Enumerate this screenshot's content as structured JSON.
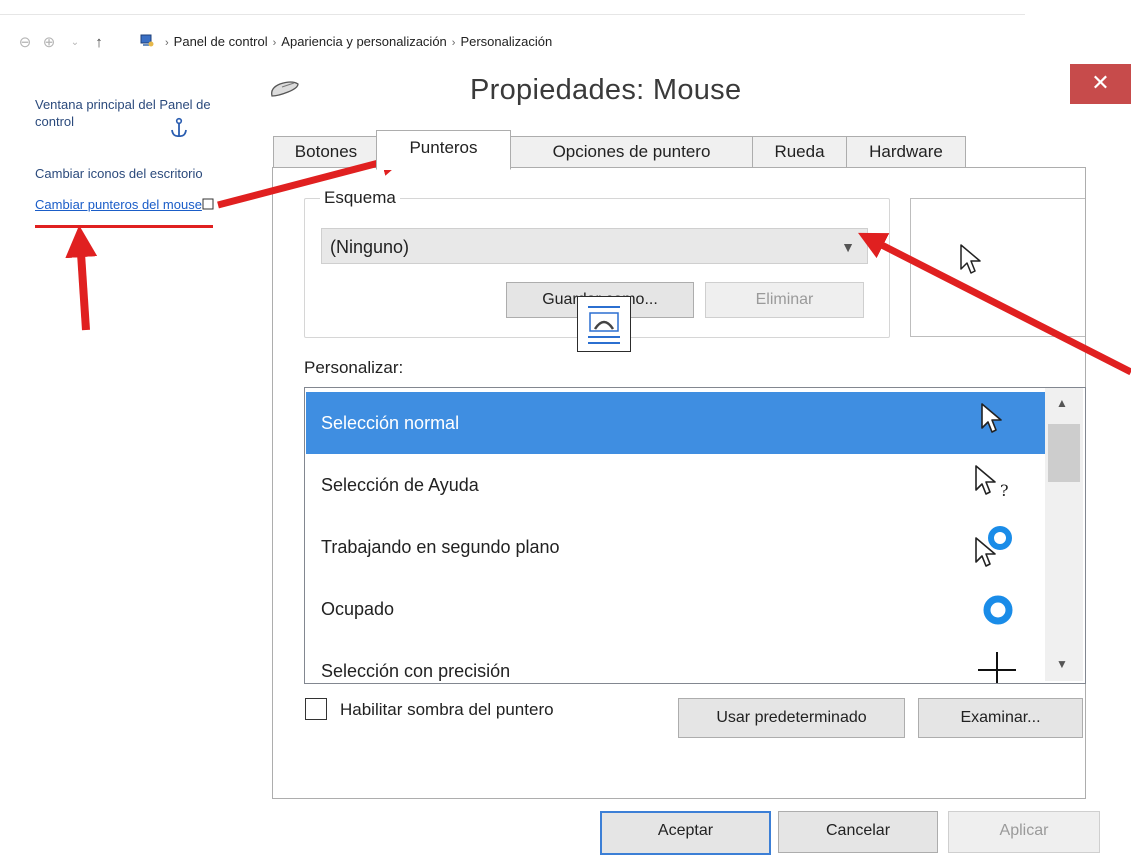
{
  "breadcrumb": {
    "items": [
      "Panel de control",
      "Apariencia y personalización",
      "Personalización"
    ],
    "separator": "›"
  },
  "left_panel": {
    "home_link": "Ventana principal del Panel de control",
    "desktop_icons_link": "Cambiar iconos del escritorio",
    "mouse_pointers_link": "Cambiar punteros del mouse"
  },
  "dialog": {
    "title": "Propiedades: Mouse",
    "close_glyph": "✕",
    "tabs": [
      "Botones",
      "Punteros",
      "Opciones de puntero",
      "Rueda",
      "Hardware"
    ],
    "active_tab": "Punteros",
    "scheme": {
      "label": "Esquema",
      "selected": "(Ninguno)",
      "save_button": "Guardar como...",
      "delete_button": "Eliminar"
    },
    "customize_label": "Personalizar:",
    "pointers": [
      {
        "label": "Selección normal",
        "icon": "arrow-pointer-icon",
        "selected": true
      },
      {
        "label": "Selección de Ayuda",
        "icon": "help-select-pointer-icon",
        "selected": false
      },
      {
        "label": "Trabajando en segundo plano",
        "icon": "working-background-pointer-icon",
        "selected": false
      },
      {
        "label": "Ocupado",
        "icon": "busy-ring-icon",
        "selected": false
      },
      {
        "label": "Selección con precisión",
        "icon": "crosshair-icon",
        "selected": false
      }
    ],
    "shadow_checkbox": {
      "label": "Habilitar sombra del puntero",
      "checked": false
    },
    "use_default_button": "Usar predeterminado",
    "browse_button": "Examinar...",
    "ok_button": "Aceptar",
    "cancel_button": "Cancelar",
    "apply_button": "Aplicar"
  },
  "colors": {
    "selection": "#3f8ee1",
    "close_button": "#c74b4b",
    "annotation_arrow": "#e02020",
    "link": "#1a5dc8"
  }
}
